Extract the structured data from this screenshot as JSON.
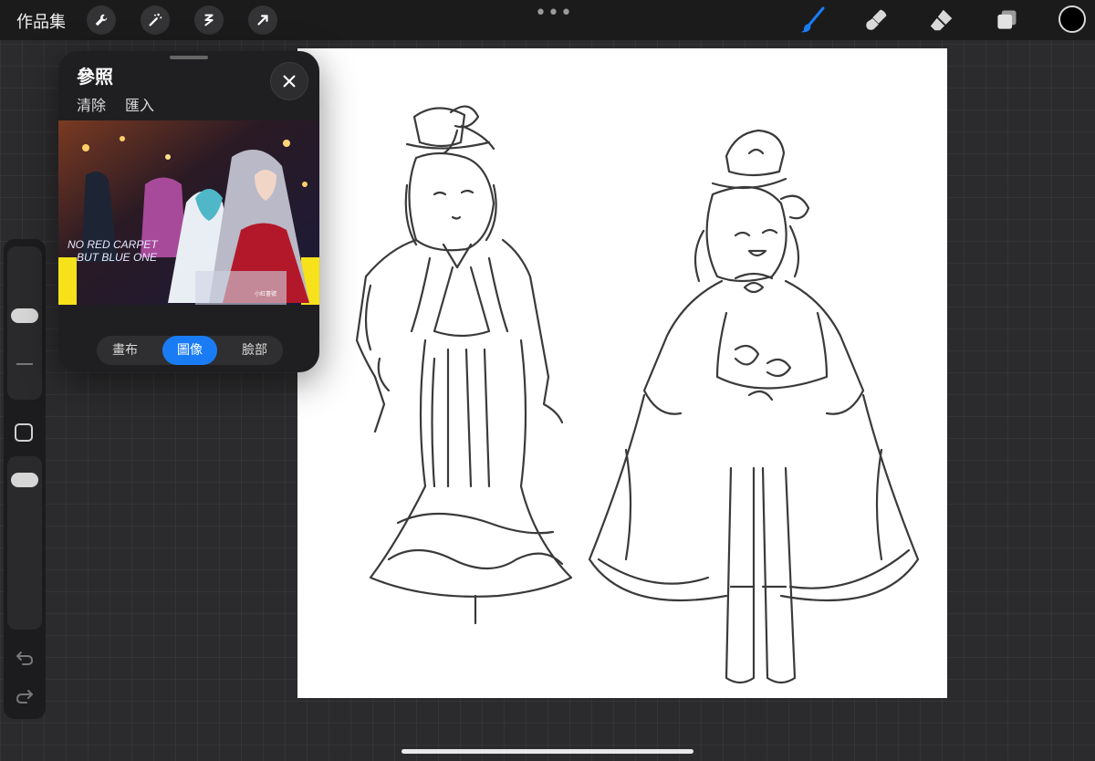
{
  "topbar": {
    "gallery_label": "作品集",
    "tools": [
      "wrench-icon",
      "magic-wand-icon",
      "selection-icon",
      "transform-arrow-icon"
    ],
    "more": "•••",
    "right_tools": [
      "brush-icon",
      "smudge-icon",
      "eraser-icon",
      "layers-icon"
    ],
    "current_color": "#000000",
    "accent_color": "#1a7cf5"
  },
  "reference_panel": {
    "title": "參照",
    "clear_label": "清除",
    "import_label": "匯入",
    "image_text_line1": "NO RED CARPET",
    "image_text_line2": "BUT BLUE ONE",
    "image_corner_text": "小紅書號",
    "segments": [
      {
        "label": "畫布",
        "active": false
      },
      {
        "label": "圖像",
        "active": true
      },
      {
        "label": "臉部",
        "active": false
      }
    ]
  }
}
